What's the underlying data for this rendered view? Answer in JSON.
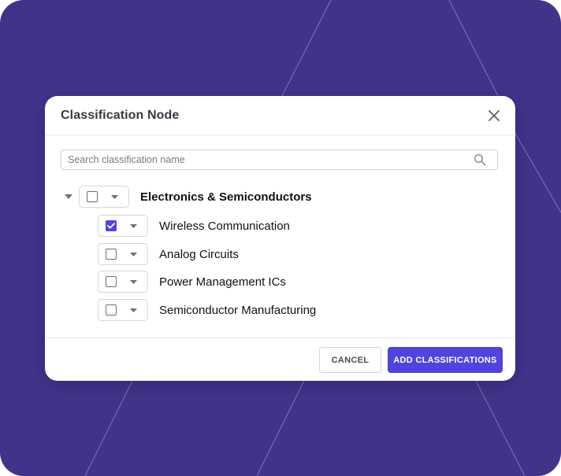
{
  "dialog": {
    "title": "Classification Node",
    "close_icon": "close-icon"
  },
  "search": {
    "placeholder": "Search classification name",
    "value": "",
    "icon": "search-icon"
  },
  "tree": {
    "root": {
      "label": "Electronics & Semiconductors",
      "checked": false,
      "expanded": true
    },
    "children": [
      {
        "label": "Wireless Communication",
        "checked": true
      },
      {
        "label": "Analog Circuits",
        "checked": false
      },
      {
        "label": "Power Management ICs",
        "checked": false
      },
      {
        "label": "Semiconductor Manufacturing",
        "checked": false
      }
    ]
  },
  "footer": {
    "cancel_label": "CANCEL",
    "add_label": "ADD CLASSIFICATIONS"
  },
  "colors": {
    "background": "#41338a",
    "accent": "#4f45de"
  }
}
